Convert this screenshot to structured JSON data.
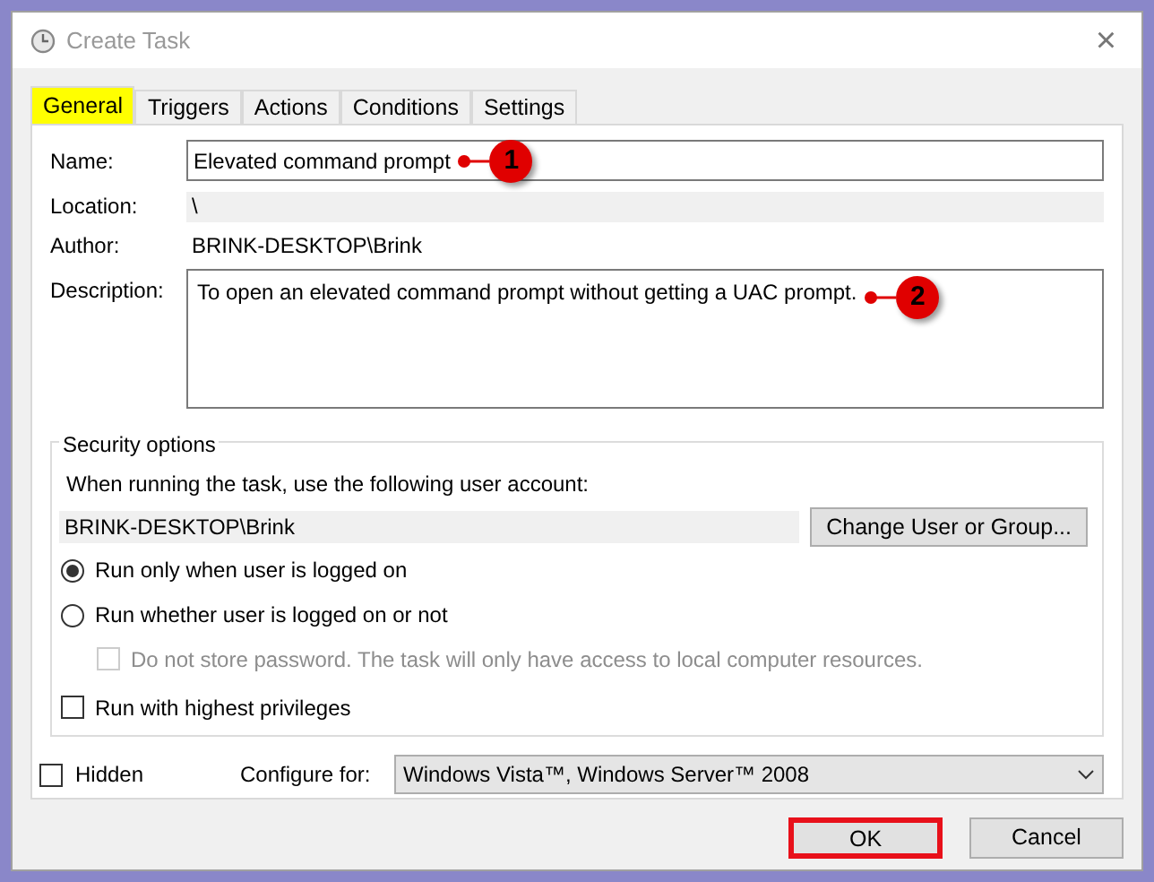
{
  "window": {
    "title": "Create Task",
    "close": "×"
  },
  "tabs": [
    {
      "label": "General",
      "selected": true,
      "highlighted": true
    },
    {
      "label": "Triggers",
      "selected": false,
      "highlighted": false
    },
    {
      "label": "Actions",
      "selected": false,
      "highlighted": false
    },
    {
      "label": "Conditions",
      "selected": false,
      "highlighted": false
    },
    {
      "label": "Settings",
      "selected": false,
      "highlighted": false
    }
  ],
  "name": {
    "label": "Name:",
    "value": "Elevated command prompt",
    "callout": "1"
  },
  "location": {
    "label": "Location:",
    "value": "\\"
  },
  "author": {
    "label": "Author:",
    "value": "BRINK-DESKTOP\\Brink"
  },
  "description": {
    "label": "Description:",
    "value": "To open an elevated command prompt without getting a UAC prompt.",
    "callout": "2"
  },
  "security": {
    "title": "Security options",
    "account_prompt": "When running the task, use the following user account:",
    "account": "BRINK-DESKTOP\\Brink",
    "change_button": "Change User or Group...",
    "options": [
      {
        "kind": "radio",
        "label": "Run only when user is logged on",
        "selected": true,
        "disabled": false
      },
      {
        "kind": "radio",
        "label": "Run whether user is logged on or not",
        "selected": false,
        "disabled": false
      },
      {
        "kind": "subcheck",
        "label": "Do not store password.  The task will only have access to local computer resources.",
        "checked": false,
        "disabled": true
      },
      {
        "kind": "checkbox",
        "label": "Run with highest privileges",
        "checked": false,
        "disabled": false
      }
    ]
  },
  "hidden": {
    "label": "Hidden",
    "checked": false
  },
  "configure": {
    "label": "Configure for:",
    "value": "Windows Vista™, Windows Server™ 2008"
  },
  "buttons": [
    {
      "label": "OK",
      "highlighted": true
    },
    {
      "label": "Cancel",
      "highlighted": false
    }
  ]
}
